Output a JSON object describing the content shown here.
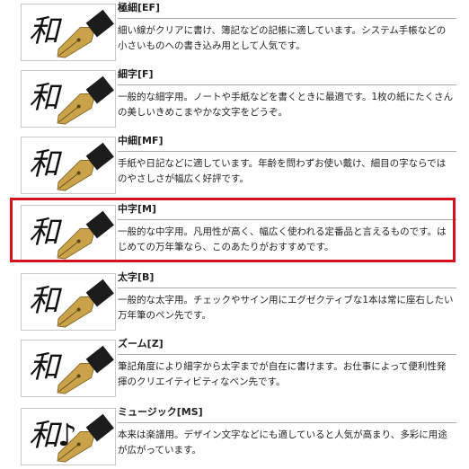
{
  "nibs": [
    {
      "kanji": "和",
      "title": "極細[EF]",
      "desc": "細い線がクリアに書け、簿記などの記帳に適しています。システム手帳などの小さいものへの書き込み用として人気です。"
    },
    {
      "kanji": "和",
      "title": "細字[F]",
      "desc": "一般的な細字用。ノートや手紙などを書くときに最適です。1枚の紙にたくさんの美しいきめこまやかな文字をどうぞ。"
    },
    {
      "kanji": "和",
      "title": "中細[MF]",
      "desc": "手紙や日記などに適しています。年齢を問わずお使い戴け、細目の字ならではのやさしさが幅広く好評です。"
    },
    {
      "kanji": "和",
      "title": "中字[M]",
      "desc": "一般的な中字用。凡用性が高く、幅広く使われる定番品と言えるものです。はじめての万年筆なら、このあたりがおすすめです。"
    },
    {
      "kanji": "和",
      "title": "太字[B]",
      "desc": "一般的な太字用。チェックやサイン用にエグゼクティブな1本は常に座右したい万年筆のペン先です。"
    },
    {
      "kanji": "和",
      "title": "ズーム[Z]",
      "desc": "筆記角度により細字から太字までが自在に書けます。お仕事によって便利性発揮のクリエイティビティなペン先です。"
    },
    {
      "kanji": "和♪",
      "title": "ミュージック[MS]",
      "desc": "本来は楽譜用。デザイン文字などにも適していると人気が高まり、多彩に用途が広がっています。"
    }
  ],
  "colors": {
    "highlight": "#d4121b",
    "nib_gold": "#c9a24a",
    "nib_dark": "#1c1c1c"
  },
  "icons": {
    "nib": "fountain-pen-nib-icon"
  }
}
